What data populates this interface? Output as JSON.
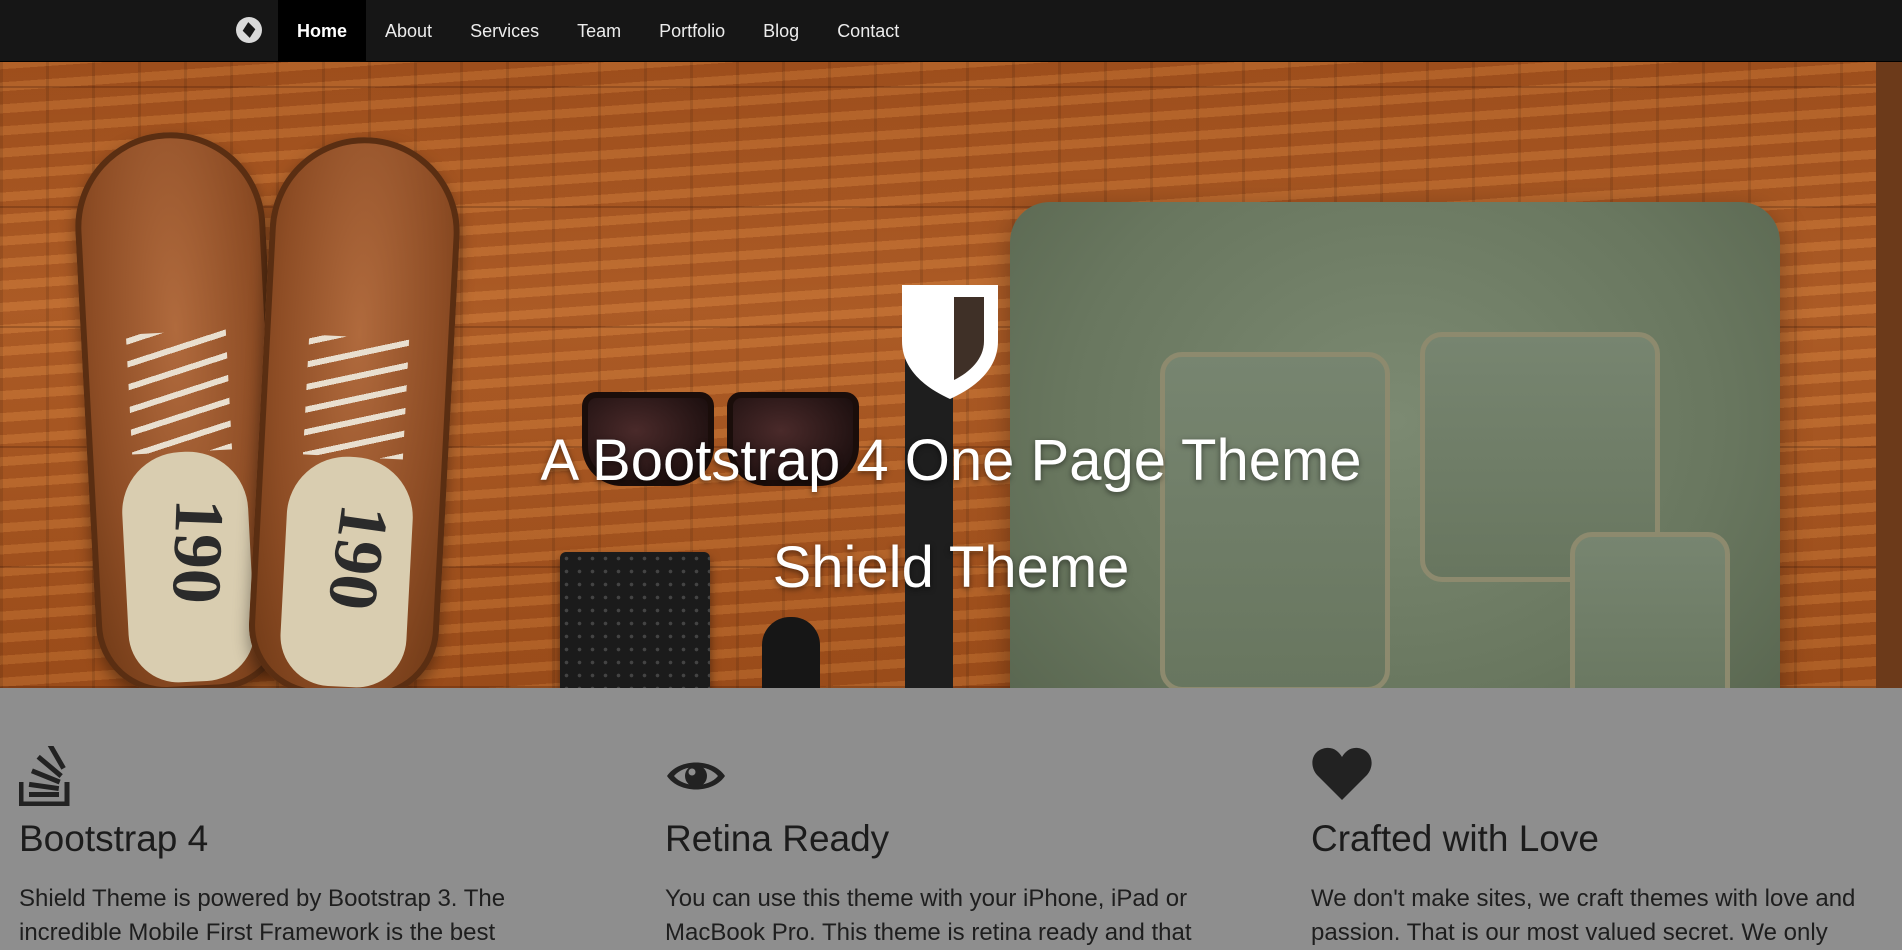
{
  "navbar": {
    "brand_icon": "circle-logo-icon",
    "items": [
      {
        "label": "Home",
        "active": true
      },
      {
        "label": "About",
        "active": false
      },
      {
        "label": "Services",
        "active": false
      },
      {
        "label": "Team",
        "active": false
      },
      {
        "label": "Portfolio",
        "active": false
      },
      {
        "label": "Blog",
        "active": false
      },
      {
        "label": "Contact",
        "active": false
      }
    ]
  },
  "hero": {
    "logo_icon": "shield-icon",
    "title": "A Bootstrap 4 One Page Theme",
    "subtitle": "Shield Theme",
    "shoe_number": "190"
  },
  "features": [
    {
      "icon": "stack-overflow-icon",
      "title": "Bootstrap 4",
      "text": "Shield Theme is powered by Bootstrap 3. The incredible Mobile First Framework is the best"
    },
    {
      "icon": "eye-icon",
      "title": "Retina Ready",
      "text": "You can use this theme with your iPhone, iPad or MacBook Pro. This theme is retina ready and that"
    },
    {
      "icon": "heart-icon",
      "title": "Crafted with Love",
      "text": "We don't make sites, we craft themes with love and passion. That is our most valued secret. We only"
    }
  ],
  "colors": {
    "navbar_bg": "#161616",
    "active_nav_bg": "#000000",
    "features_bg": "#8e8e8e",
    "hero_text": "#ffffff"
  }
}
